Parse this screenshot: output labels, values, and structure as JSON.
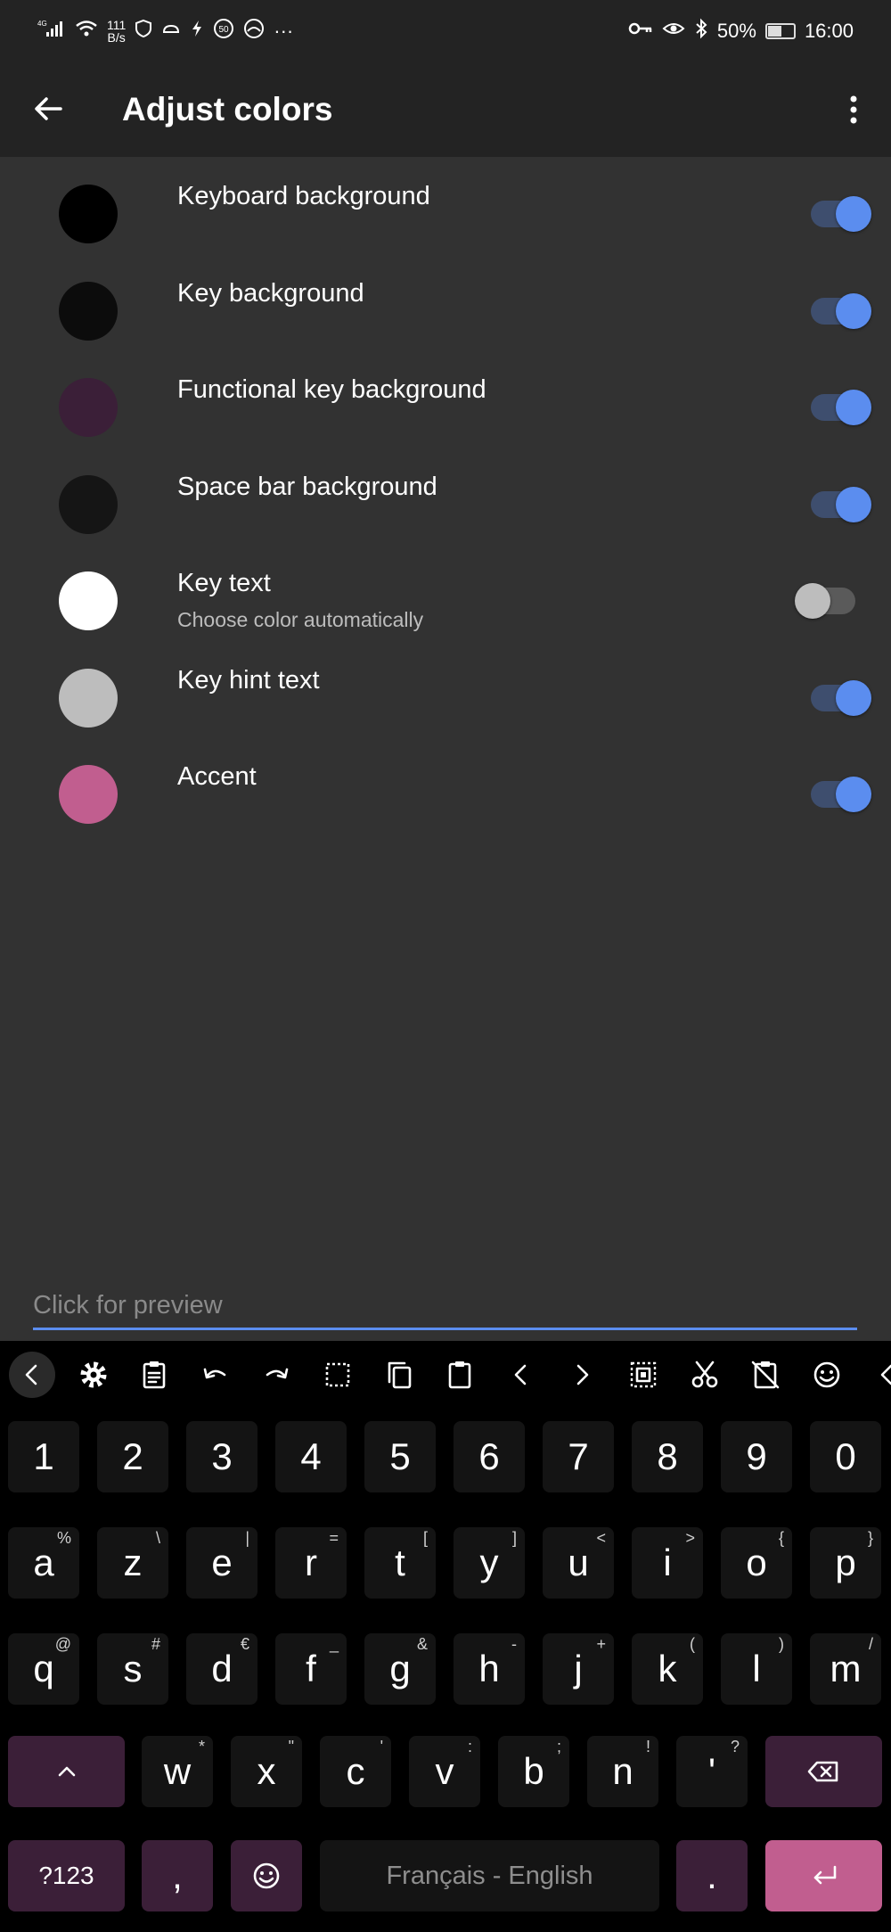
{
  "status_bar": {
    "signal_label": "4G",
    "net_speed_value": "111",
    "net_speed_unit": "B/s",
    "alarm_badge": "50",
    "more_glyph": "···",
    "battery": "50%",
    "battery_level": 0.5,
    "time": "16:00"
  },
  "app_bar": {
    "title": "Adjust colors",
    "back_icon": "arrow-left-icon",
    "menu_icon": "more-vert-icon"
  },
  "settings": [
    {
      "title": "Keyboard background",
      "subtitle": "",
      "color": "#000000",
      "enabled": true
    },
    {
      "title": "Key background",
      "subtitle": "",
      "color": "#0c0c0c",
      "enabled": true
    },
    {
      "title": "Functional key background",
      "subtitle": "",
      "color": "#3b1f38",
      "enabled": true
    },
    {
      "title": "Space bar background",
      "subtitle": "",
      "color": "#151515",
      "enabled": true
    },
    {
      "title": "Key text",
      "subtitle": "Choose color automatically",
      "color": "#ffffff",
      "enabled": false
    },
    {
      "title": "Key hint text",
      "subtitle": "",
      "color": "#bdbdbd",
      "enabled": true
    },
    {
      "title": "Accent",
      "subtitle": "",
      "color": "#c15e8f",
      "enabled": true
    }
  ],
  "preview": {
    "placeholder": "Click for preview"
  },
  "keyboard": {
    "toolbar_icons": [
      "chevron-left-icon",
      "settings-icon",
      "clipboard-icon",
      "undo-icon",
      "redo-icon",
      "select-all-icon",
      "copy-icon",
      "paste-icon",
      "cursor-left-icon",
      "cursor-right-icon",
      "select-word-icon",
      "cut-icon",
      "clear-clipboard-icon",
      "emoji-icon",
      "chevron-left-icon"
    ],
    "row_numbers": [
      "1",
      "2",
      "3",
      "4",
      "5",
      "6",
      "7",
      "8",
      "9",
      "0"
    ],
    "row1": [
      {
        "label": "a",
        "hint": "%"
      },
      {
        "label": "z",
        "hint": "\\"
      },
      {
        "label": "e",
        "hint": "|"
      },
      {
        "label": "r",
        "hint": "="
      },
      {
        "label": "t",
        "hint": "["
      },
      {
        "label": "y",
        "hint": "]"
      },
      {
        "label": "u",
        "hint": "<"
      },
      {
        "label": "i",
        "hint": ">"
      },
      {
        "label": "o",
        "hint": "{"
      },
      {
        "label": "p",
        "hint": "}"
      }
    ],
    "row2": [
      {
        "label": "q",
        "hint": "@"
      },
      {
        "label": "s",
        "hint": "#"
      },
      {
        "label": "d",
        "hint": "€"
      },
      {
        "label": "f",
        "hint": "_"
      },
      {
        "label": "g",
        "hint": "&"
      },
      {
        "label": "h",
        "hint": "-"
      },
      {
        "label": "j",
        "hint": "+"
      },
      {
        "label": "k",
        "hint": "("
      },
      {
        "label": "l",
        "hint": ")"
      },
      {
        "label": "m",
        "hint": "/"
      }
    ],
    "row3": [
      {
        "label": "w",
        "hint": "*"
      },
      {
        "label": "x",
        "hint": "\""
      },
      {
        "label": "c",
        "hint": "'"
      },
      {
        "label": "v",
        "hint": ":"
      },
      {
        "label": "b",
        "hint": ";"
      },
      {
        "label": "n",
        "hint": "!"
      },
      {
        "label": "'",
        "hint": "?"
      }
    ],
    "shift_icon": "shift-icon",
    "backspace_icon": "backspace-icon",
    "symbols_label": "?123",
    "comma_label": ",",
    "emoji_key_icon": "emoji-icon",
    "space_label": "Français - English",
    "period_label": ".",
    "enter_icon": "enter-icon"
  }
}
